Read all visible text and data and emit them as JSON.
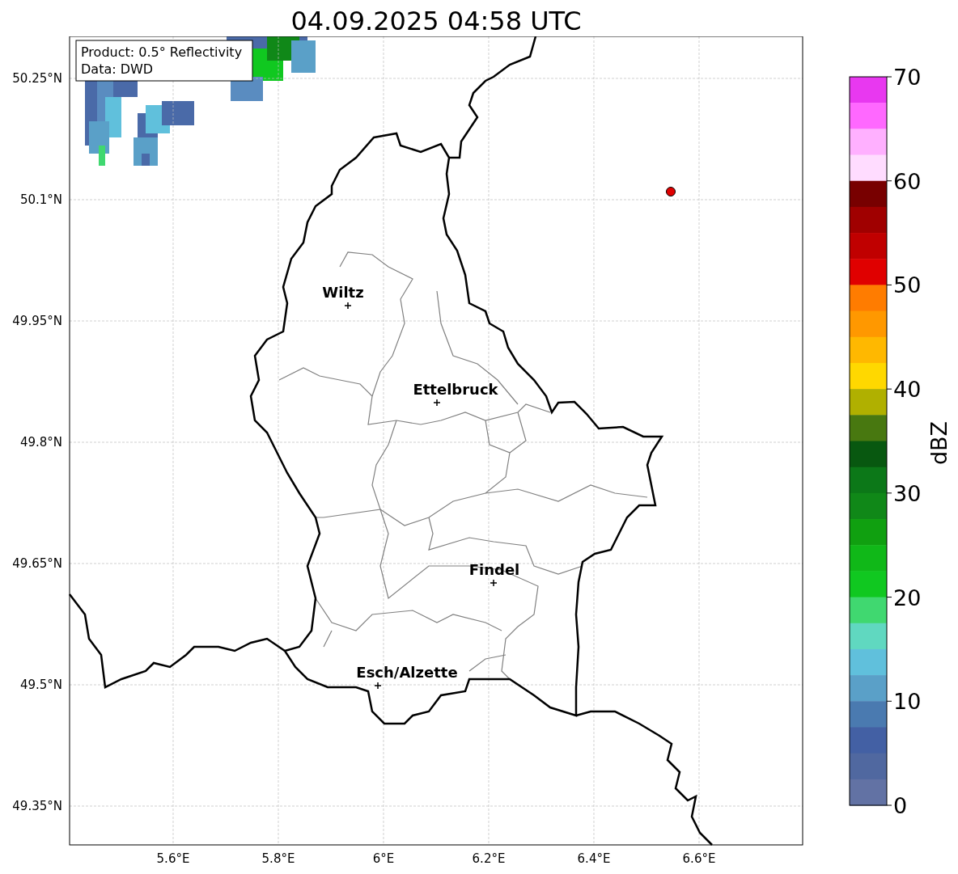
{
  "title": "04.09.2025 04:58 UTC",
  "legend": [
    "Product: 0.5° Reflectivity",
    "Data: DWD"
  ],
  "y_ticks": [
    "50.25°N",
    "50.1°N",
    "49.95°N",
    "49.8°N",
    "49.65°N",
    "49.5°N",
    "49.35°N"
  ],
  "x_ticks": [
    "5.6°E",
    "5.8°E",
    "6°E",
    "6.2°E",
    "6.4°E",
    "6.6°E"
  ],
  "cities": [
    {
      "name": "Wiltz"
    },
    {
      "name": "Ettelbruck"
    },
    {
      "name": "Findel"
    },
    {
      "name": "Esch/Alzette"
    }
  ],
  "colorbar": {
    "label": "dBZ",
    "ticks": [
      "70",
      "60",
      "50",
      "40",
      "30",
      "20",
      "10",
      "0"
    ],
    "segments": [
      {
        "color": "#e838f0"
      },
      {
        "color": "#ff68ff"
      },
      {
        "color": "#ffb0ff"
      },
      {
        "color": "#ffdcff"
      },
      {
        "color": "#780000"
      },
      {
        "color": "#a00000"
      },
      {
        "color": "#c00000"
      },
      {
        "color": "#e00000"
      },
      {
        "color": "#ff7c00"
      },
      {
        "color": "#ff9800"
      },
      {
        "color": "#ffb800"
      },
      {
        "color": "#ffd800"
      },
      {
        "color": "#b0b000"
      },
      {
        "color": "#487810"
      },
      {
        "color": "#085810"
      },
      {
        "color": "#0c7818"
      },
      {
        "color": "#108818"
      },
      {
        "color": "#10a010"
      },
      {
        "color": "#10b818"
      },
      {
        "color": "#10c820"
      },
      {
        "color": "#40d870"
      },
      {
        "color": "#60d8c0"
      },
      {
        "color": "#60c0dc"
      },
      {
        "color": "#5aa0c8"
      },
      {
        "color": "#4a7ab0"
      },
      {
        "color": "#4360a4"
      },
      {
        "color": "#5068a0"
      },
      {
        "color": "#6272a4"
      }
    ]
  }
}
